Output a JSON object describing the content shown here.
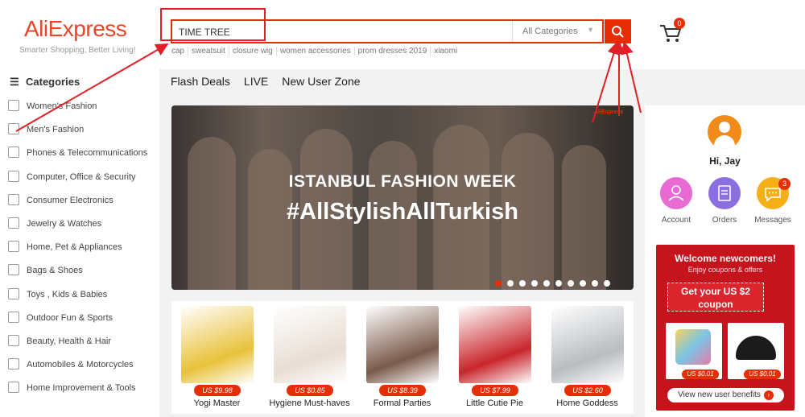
{
  "header": {
    "logo": "AliExpress",
    "slogan": "Smarter Shopping, Better Living!",
    "search": {
      "value": "TIME TREE",
      "category": "All Categories"
    },
    "hot_words": [
      "cap",
      "sweatsuit",
      "closure wig",
      "women accessories",
      "prom dresses 2019",
      "xiaomi"
    ],
    "cart_count": "0"
  },
  "sidebar": {
    "title": "Categories",
    "items": [
      "Women's Fashion",
      "Men's Fashion",
      "Phones & Telecommunications",
      "Computer, Office & Security",
      "Consumer Electronics",
      "Jewelry & Watches",
      "Home, Pet & Appliances",
      "Bags & Shoes",
      "Toys , Kids & Babies",
      "Outdoor Fun & Sports",
      "Beauty, Health & Hair",
      "Automobiles & Motorcycles",
      "Home Improvement & Tools"
    ]
  },
  "nav": [
    "Flash Deals",
    "LIVE",
    "New User Zone"
  ],
  "banner": {
    "title": "ISTANBUL FASHION WEEK",
    "subtitle": "#AllStylishAllTurkish",
    "brand": "AliExpress",
    "slides": 10,
    "active_slide": 1
  },
  "products": [
    {
      "price": "US $9.98",
      "name": "Yogi Master",
      "color": "#e8c23a"
    },
    {
      "price": "US $0.85",
      "name": "Hygiene Must-haves",
      "color": "#e8ddd3"
    },
    {
      "price": "US $8.39",
      "name": "Formal Parties",
      "color": "#7a5a4a"
    },
    {
      "price": "US $7.99",
      "name": "Little Cutie Pie",
      "color": "#c8262c"
    },
    {
      "price": "US $2.60",
      "name": "Home Goddess",
      "color": "#b9bcc0"
    }
  ],
  "user": {
    "greeting": "Hi, Jay",
    "actions": [
      {
        "label": "Account",
        "color": "#e96ad3"
      },
      {
        "label": "Orders",
        "color": "#8b6fe0"
      },
      {
        "label": "Messages",
        "color": "#f5b019",
        "badge": "3"
      }
    ]
  },
  "welcome": {
    "title": "Welcome newcomers!",
    "subtitle": "Enjoy coupons & offers",
    "coupon_line1": "Get your US $2",
    "coupon_line2": "coupon",
    "items": [
      {
        "price": "US $0.01"
      },
      {
        "price": "US $0.01"
      }
    ],
    "view_label": "View new user benefits"
  }
}
